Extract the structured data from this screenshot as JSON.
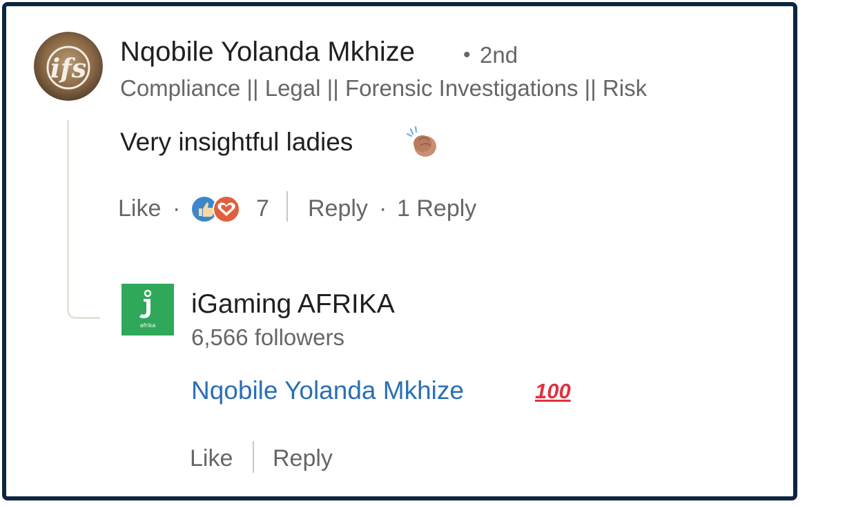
{
  "comment": {
    "author": "Nqobile Yolanda Mkhize",
    "dot": "•",
    "degree": "2nd",
    "headline": "Compliance || Legal || Forensic Investigations || Risk",
    "avatar_text": "ifs",
    "text": "Very insightful ladies",
    "text_emoji_icon": "clapping-hands-icon",
    "actions": {
      "like": "Like",
      "sep": "·",
      "reaction_icons": [
        "like-reaction-icon",
        "love-reaction-icon"
      ],
      "reaction_count": "7",
      "reply": "Reply",
      "reply_sep": "·",
      "reply_count": "1 Reply"
    }
  },
  "reply": {
    "company": "iGaming AFRIKA",
    "followers": "6,566 followers",
    "logo_color": "#2fa85a",
    "logo_text": "afrika",
    "mention": "Nqobile Yolanda Mkhize",
    "emoji": "100",
    "actions": {
      "like": "Like",
      "reply": "Reply"
    }
  },
  "colors": {
    "frame": "#0d2540",
    "link": "#2a6fb5",
    "muted": "#666666",
    "text": "#1f1f1f"
  }
}
